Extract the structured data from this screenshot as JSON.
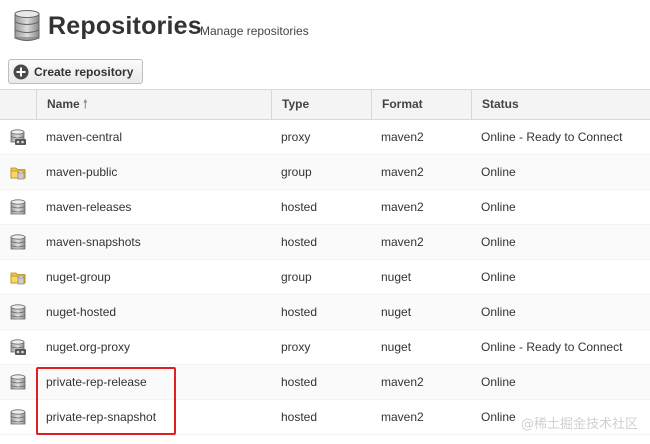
{
  "header": {
    "title": "Repositories",
    "subtitle": "Manage repositories",
    "icon": "database-icon"
  },
  "toolbar": {
    "create_label": "Create repository",
    "create_icon": "plus-circle-icon"
  },
  "table": {
    "columns": {
      "name": "Name",
      "type": "Type",
      "format": "Format",
      "status": "Status"
    },
    "sort": {
      "column": "Name",
      "direction": "ascending",
      "icon": "sort-up-arrow-icon"
    },
    "rows": [
      {
        "icon": "proxy-repo-icon",
        "name": "maven-central",
        "type": "proxy",
        "format": "maven2",
        "status": "Online - Ready to Connect"
      },
      {
        "icon": "group-folder-icon",
        "name": "maven-public",
        "type": "group",
        "format": "maven2",
        "status": "Online"
      },
      {
        "icon": "hosted-repo-icon",
        "name": "maven-releases",
        "type": "hosted",
        "format": "maven2",
        "status": "Online"
      },
      {
        "icon": "hosted-repo-icon",
        "name": "maven-snapshots",
        "type": "hosted",
        "format": "maven2",
        "status": "Online"
      },
      {
        "icon": "group-folder-icon",
        "name": "nuget-group",
        "type": "group",
        "format": "nuget",
        "status": "Online"
      },
      {
        "icon": "hosted-repo-icon",
        "name": "nuget-hosted",
        "type": "hosted",
        "format": "nuget",
        "status": "Online"
      },
      {
        "icon": "proxy-repo-icon",
        "name": "nuget.org-proxy",
        "type": "proxy",
        "format": "nuget",
        "status": "Online - Ready to Connect"
      },
      {
        "icon": "hosted-repo-icon",
        "name": "private-rep-release",
        "type": "hosted",
        "format": "maven2",
        "status": "Online"
      },
      {
        "icon": "hosted-repo-icon",
        "name": "private-rep-snapshot",
        "type": "hosted",
        "format": "maven2",
        "status": "Online"
      }
    ]
  },
  "annotation": {
    "color": "#e02020",
    "rows_highlighted": [
      "private-rep-release",
      "private-rep-snapshot"
    ]
  },
  "watermark": "@稀土掘金技术社区"
}
